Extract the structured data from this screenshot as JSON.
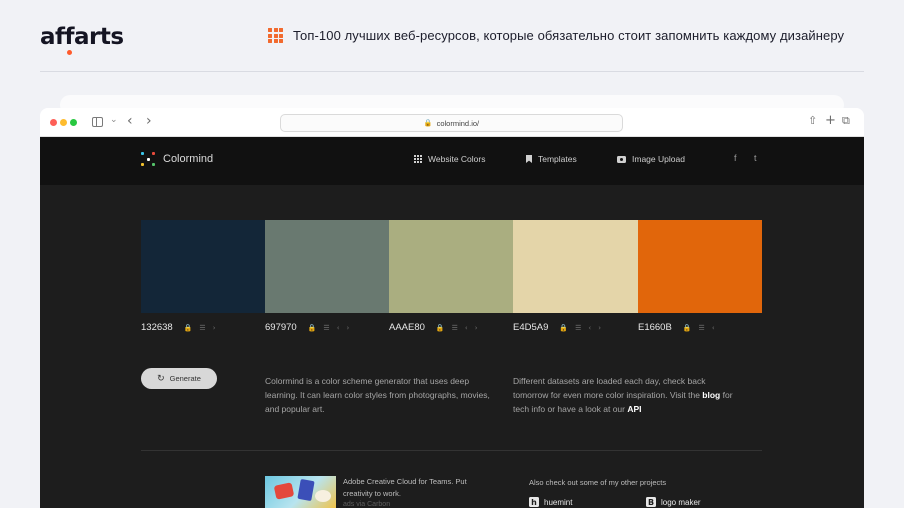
{
  "header": {
    "logo": "affarts",
    "headline": "Топ-100 лучших веб-ресурсов, которые обязательно стоит запомнить каждому дизайнеру"
  },
  "browser": {
    "url": "colormind.io/"
  },
  "site": {
    "brand": "Colormind",
    "nav": {
      "website_colors": "Website Colors",
      "templates": "Templates",
      "image_upload": "Image Upload",
      "facebook": "f",
      "twitter": "t"
    },
    "palette": [
      {
        "hex": "132638",
        "color": "#132638"
      },
      {
        "hex": "697970",
        "color": "#697970"
      },
      {
        "hex": "AAAE80",
        "color": "#AAAE80"
      },
      {
        "hex": "E4D5A9",
        "color": "#E4D5A9"
      },
      {
        "hex": "E1660B",
        "color": "#E1660B"
      }
    ],
    "generate_label": "Generate",
    "description_left": "Colormind is a color scheme generator that uses deep learning. It can learn color styles from photographs, movies, and popular art.",
    "description_right": {
      "part1": "Different datasets are loaded each day, check back tomorrow for even more color inspiration. Visit the ",
      "blog": "blog",
      "part2": " for tech info or have a look at our ",
      "api": "API"
    },
    "ad": {
      "text": "Adobe Creative Cloud for Teams. Put creativity to work.",
      "via": "ads via Carbon"
    },
    "projects": {
      "title": "Also check out some of my other projects",
      "items": [
        {
          "icon": "h",
          "label": "huemint"
        },
        {
          "icon": "B",
          "label": "logo maker"
        }
      ]
    }
  }
}
